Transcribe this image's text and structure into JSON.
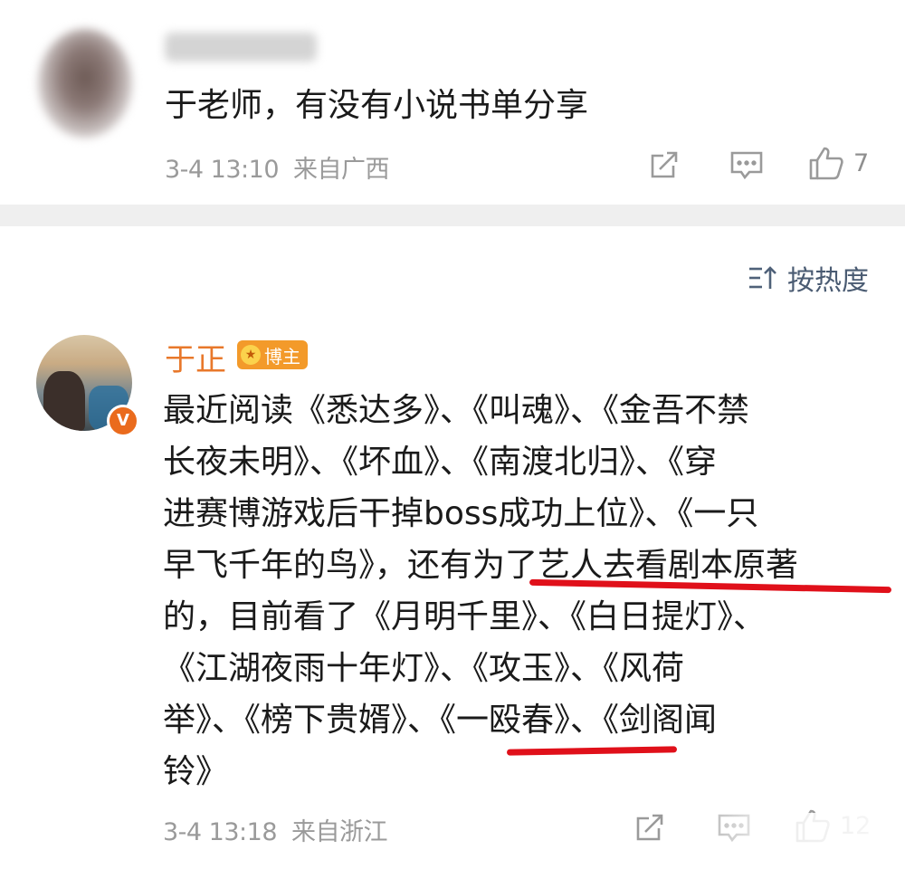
{
  "comment1": {
    "text": "于老师，有没有小说书单分享",
    "time": "3-4 13:10",
    "location": "来自广西",
    "like_count": "7"
  },
  "sort": {
    "label": "按热度"
  },
  "comment2": {
    "author": "于正",
    "badge": "博主",
    "verified_mark": "V",
    "lines": [
      "最近阅读《悉达多》、《叫魂》、《金吾不禁",
      "长夜未明》、《坏血》、《南渡北归》、《穿",
      "进赛博游戏后干掉boss成功上位》、《一只",
      "早飞千年的鸟》，还有为了艺人去看剧本原著",
      "的，目前看了《月明千里》、《白日提灯》、",
      "《江湖夜雨十年灯》、《攻玉》、《风荷",
      "举》、《榜下贵婿》、《一殴春》、《剑阁闻",
      "铃》"
    ],
    "time": "3-4 13:18",
    "location": "来自浙江",
    "like_count": "12"
  },
  "colors": {
    "author": "#e8782b",
    "meta": "#9a9a9a",
    "annotation": "#e0101a",
    "sort": "#4a5b72"
  }
}
